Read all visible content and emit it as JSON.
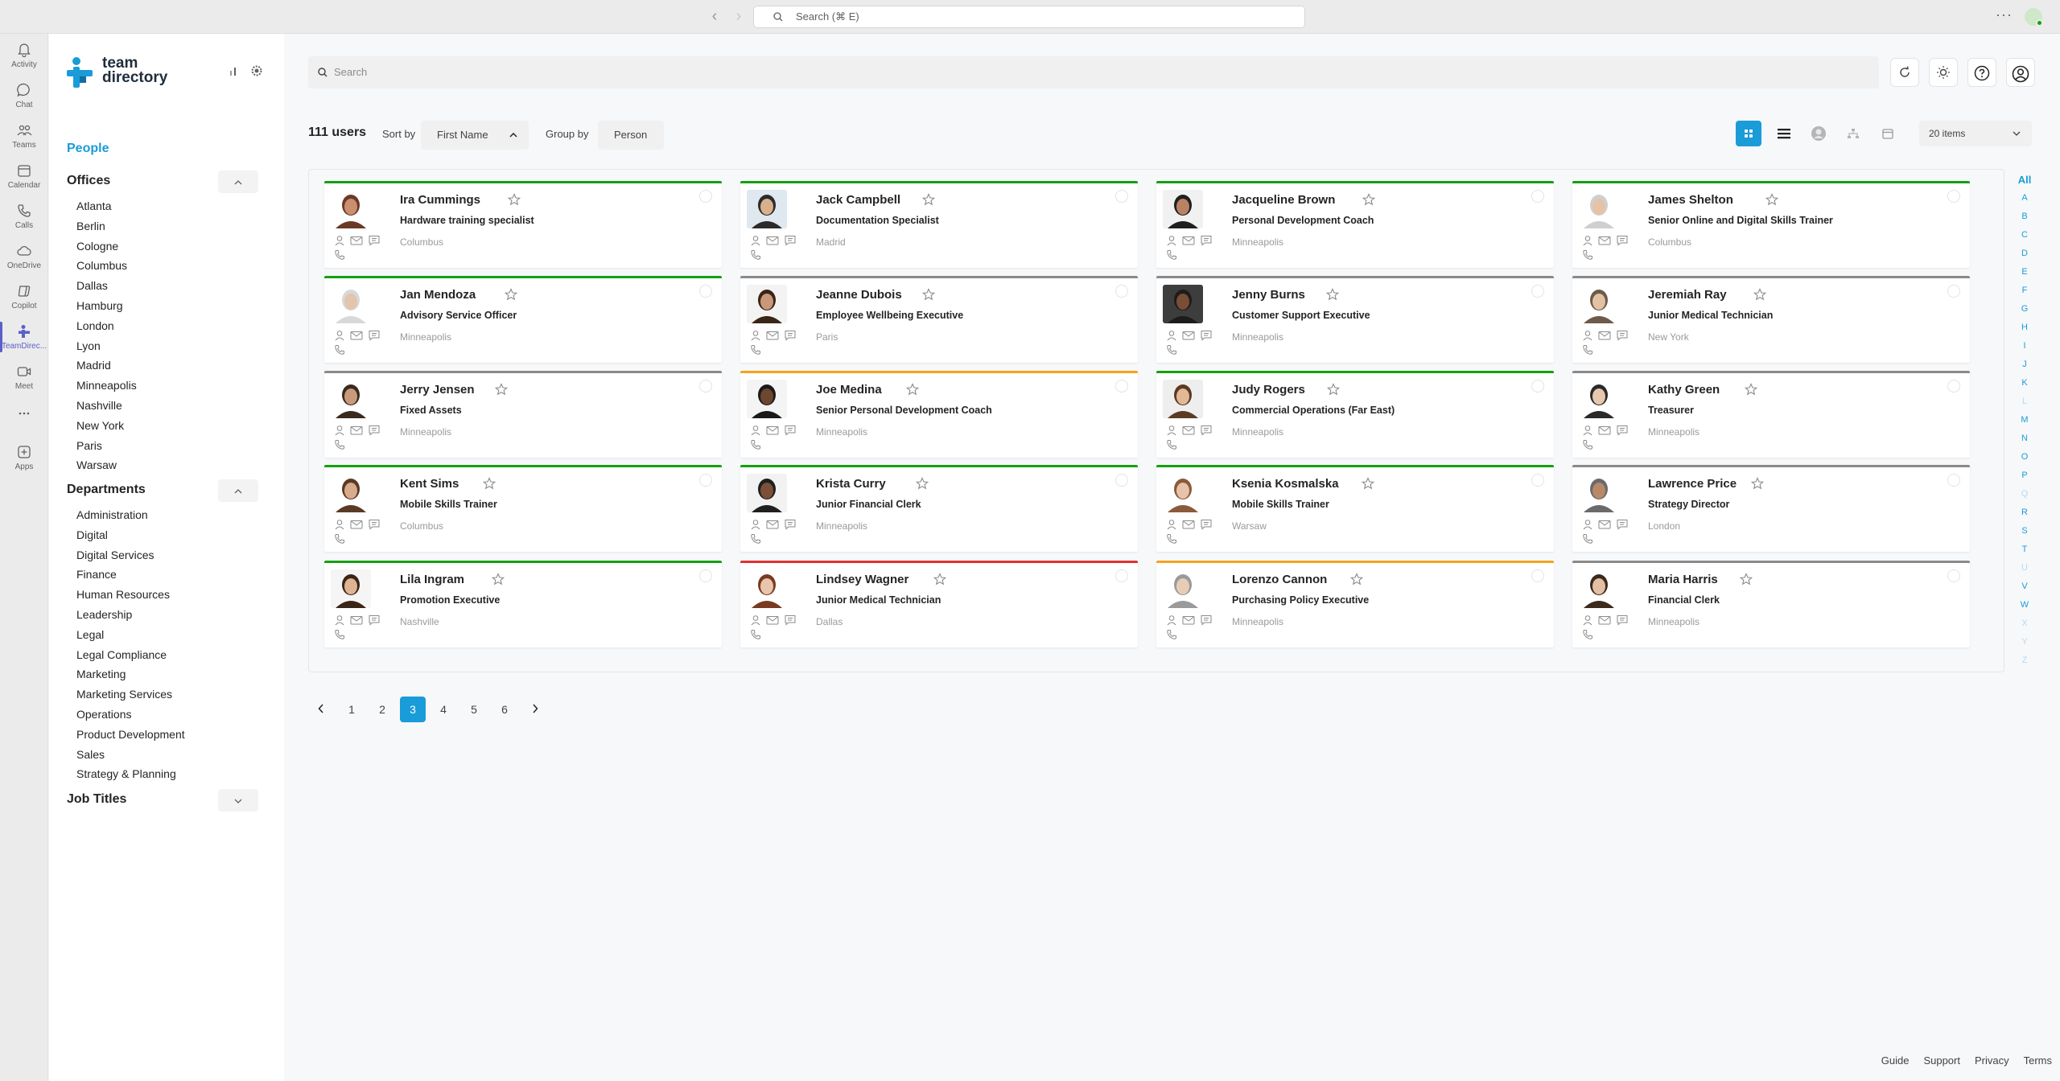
{
  "titlebar": {
    "search_placeholder": "Search (⌘ E)"
  },
  "rail": [
    {
      "label": "Activity",
      "icon": "bell-icon"
    },
    {
      "label": "Chat",
      "icon": "chat-icon"
    },
    {
      "label": "Teams",
      "icon": "teams-icon"
    },
    {
      "label": "Calendar",
      "icon": "calendar-icon"
    },
    {
      "label": "Calls",
      "icon": "phone-icon"
    },
    {
      "label": "OneDrive",
      "icon": "cloud-icon"
    },
    {
      "label": "Copilot",
      "icon": "copilot-icon"
    },
    {
      "label": "TeamDirec...",
      "icon": "team-directory-icon"
    },
    {
      "label": "Meet",
      "icon": "video-icon"
    },
    {
      "label": "...",
      "icon": "more-icon"
    },
    {
      "label": "Apps",
      "icon": "apps-icon"
    }
  ],
  "sidebar": {
    "logo_line1": "team",
    "logo_line2": "directory",
    "people": "People",
    "offices_title": "Offices",
    "offices": [
      "Atlanta",
      "Berlin",
      "Cologne",
      "Columbus",
      "Dallas",
      "Hamburg",
      "London",
      "Lyon",
      "Madrid",
      "Minneapolis",
      "Nashville",
      "New York",
      "Paris",
      "Warsaw"
    ],
    "departments_title": "Departments",
    "departments": [
      "Administration",
      "Digital",
      "Digital Services",
      "Finance",
      "Human Resources",
      "Leadership",
      "Legal",
      "Legal Compliance",
      "Marketing",
      "Marketing Services",
      "Operations",
      "Product Development",
      "Sales",
      "Strategy & Planning"
    ],
    "job_titles_title": "Job Titles"
  },
  "main": {
    "search_placeholder": "Search",
    "users_count": "111 users",
    "sort_label": "Sort by",
    "sort_value": "First Name",
    "group_label": "Group by",
    "group_value": "Person",
    "items_value": "20 items"
  },
  "cards": [
    {
      "name": "Ira Cummings",
      "title": "Hardware training specialist",
      "city": "Columbus",
      "status": "green"
    },
    {
      "name": "Jack Campbell",
      "title": "Documentation Specialist",
      "city": "Madrid",
      "status": "green"
    },
    {
      "name": "Jacqueline Brown",
      "title": "Personal Development Coach",
      "city": "Minneapolis",
      "status": "green"
    },
    {
      "name": "James Shelton",
      "title": "Senior Online and Digital Skills Trainer",
      "city": "Columbus",
      "status": "green"
    },
    {
      "name": "Jan Mendoza",
      "title": "Advisory Service Officer",
      "city": "Minneapolis",
      "status": "green"
    },
    {
      "name": "Jeanne Dubois",
      "title": "Employee Wellbeing Executive",
      "city": "Paris",
      "status": "gray"
    },
    {
      "name": "Jenny Burns",
      "title": "Customer Support Executive",
      "city": "Minneapolis",
      "status": "gray"
    },
    {
      "name": "Jeremiah Ray",
      "title": "Junior Medical Technician",
      "city": "New York",
      "status": "gray"
    },
    {
      "name": "Jerry Jensen",
      "title": "Fixed Assets",
      "city": "Minneapolis",
      "status": "gray"
    },
    {
      "name": "Joe Medina",
      "title": "Senior Personal Development Coach",
      "city": "Minneapolis",
      "status": "orange"
    },
    {
      "name": "Judy Rogers",
      "title": "Commercial Operations (Far East)",
      "city": "Minneapolis",
      "status": "green"
    },
    {
      "name": "Kathy Green",
      "title": "Treasurer",
      "city": "Minneapolis",
      "status": "gray"
    },
    {
      "name": "Kent Sims",
      "title": "Mobile Skills Trainer",
      "city": "Columbus",
      "status": "green"
    },
    {
      "name": "Krista Curry",
      "title": "Junior Financial Clerk",
      "city": "Minneapolis",
      "status": "green"
    },
    {
      "name": "Ksenia Kosmalska",
      "title": "Mobile Skills Trainer",
      "city": "Warsaw",
      "status": "green"
    },
    {
      "name": "Lawrence Price",
      "title": "Strategy Director",
      "city": "London",
      "status": "gray"
    },
    {
      "name": "Lila Ingram",
      "title": "Promotion Executive",
      "city": "Nashville",
      "status": "green"
    },
    {
      "name": "Lindsey Wagner",
      "title": "Junior Medical Technician",
      "city": "Dallas",
      "status": "red"
    },
    {
      "name": "Lorenzo Cannon",
      "title": "Purchasing Policy Executive",
      "city": "Minneapolis",
      "status": "orange"
    },
    {
      "name": "Maria Harris",
      "title": "Financial Clerk",
      "city": "Minneapolis",
      "status": "gray"
    }
  ],
  "alphabet": [
    "All",
    "A",
    "B",
    "C",
    "D",
    "E",
    "F",
    "G",
    "H",
    "I",
    "J",
    "K",
    "L",
    "M",
    "N",
    "O",
    "P",
    "Q",
    "R",
    "S",
    "T",
    "U",
    "V",
    "W",
    "X",
    "Y",
    "Z"
  ],
  "pagination": {
    "pages": [
      "1",
      "2",
      "3",
      "4",
      "5",
      "6"
    ],
    "current": "3"
  },
  "footer": [
    "Guide",
    "Support",
    "Privacy",
    "Terms"
  ],
  "colors": {
    "accent": "#1a9cd8",
    "green": "#13a10e",
    "gray": "#8a8a8a",
    "orange": "#f7a21a",
    "red": "#e03131"
  }
}
